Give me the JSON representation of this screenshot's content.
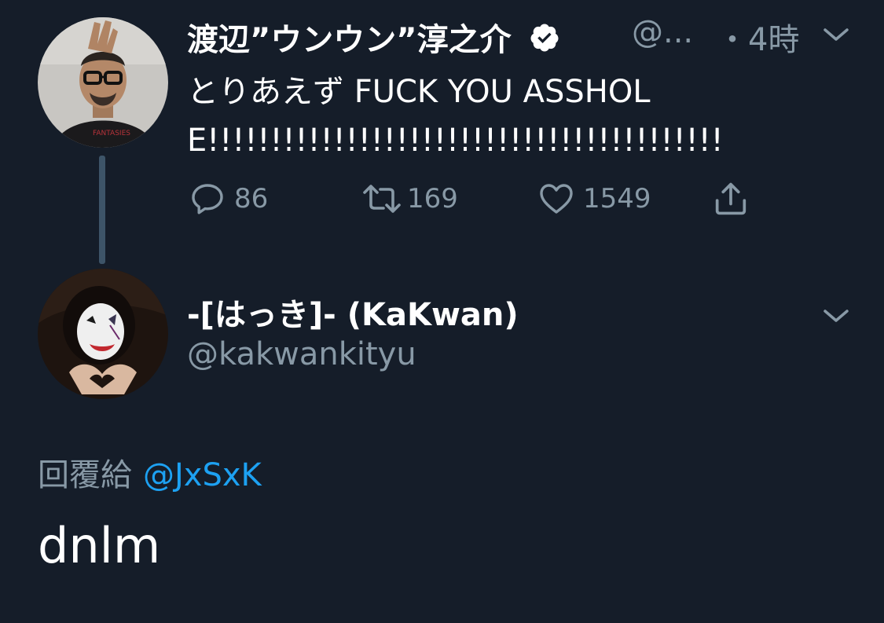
{
  "original_tweet": {
    "author_name": "渡辺”ウンウン”淳之介",
    "verified": true,
    "handle": "@...",
    "time": "・4時",
    "text": "とりあえず FUCK YOU ASSHOLE!!!!!!!!!!!!!!!!!!!!!!!!!!!!!!!!!!!!!!!!!",
    "actions": {
      "reply_count": "86",
      "retweet_count": "169",
      "like_count": "1549"
    }
  },
  "reply_tweet": {
    "author_name": "-[はっき]- (KaKwan)",
    "handle": "@kakwankityu",
    "reply_to_label": "回覆給",
    "reply_to_handle": "@JxSxK",
    "text": "dnlm"
  },
  "colors": {
    "background": "#151d29",
    "secondary_text": "#8899a6",
    "link": "#1da1f2",
    "thread_line": "#3d5468"
  },
  "icons": [
    "verified-badge-icon",
    "chevron-down-icon",
    "reply-icon",
    "retweet-icon",
    "like-icon",
    "share-icon"
  ]
}
